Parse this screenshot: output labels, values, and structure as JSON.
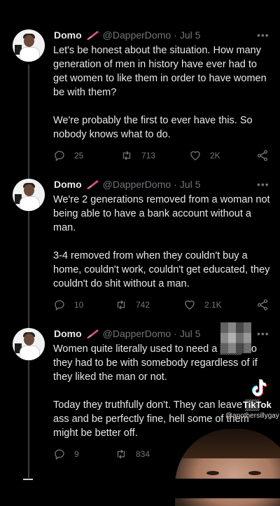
{
  "colors": {
    "background": "#000000",
    "text": "#e7e9ea",
    "muted": "#71767b",
    "brush": "#d64d8a"
  },
  "tweets": [
    {
      "name": "Domo",
      "handle": "@DapperDomo",
      "date": "Jul 5",
      "paragraphs": [
        "Let's be honest about the situation. How many generation of men in history have ever had to get women to like them in order to have women be with them?",
        "We're probably the first to ever have this. So nobody knows what to do."
      ],
      "replies": "25",
      "retweets": "713",
      "likes": "2K"
    },
    {
      "name": "Domo",
      "handle": "@DapperDomo",
      "date": "Jul 5",
      "paragraphs": [
        "We're 2 generations removed from a woman not being able to have a bank account without a man.",
        "3-4 removed from when they couldn't buy a home, couldn't work, couldn't get educated, they couldn't do shit without a man."
      ],
      "replies": "10",
      "retweets": "742",
      "likes": "2.1K"
    },
    {
      "name": "Domo",
      "handle": "@DapperDomo",
      "date": "Jul 5",
      "paragraphs": [
        "Women quite literally used to need a ▒▒▒ So they had to be with somebody regardless of if they liked the man or not.",
        "Today they truthfully don't. They can leave ▒▒ ass and be perfectly fine, hell some of them might be better off."
      ],
      "replies": "9",
      "retweets": "834"
    }
  ],
  "overlay": {
    "brand": "TikTok",
    "user": "@anothersillygay"
  },
  "icons": [
    "reply-icon",
    "retweet-icon",
    "like-icon",
    "share-icon",
    "more-icon",
    "paintbrush-icon",
    "tiktok-logo-icon"
  ]
}
